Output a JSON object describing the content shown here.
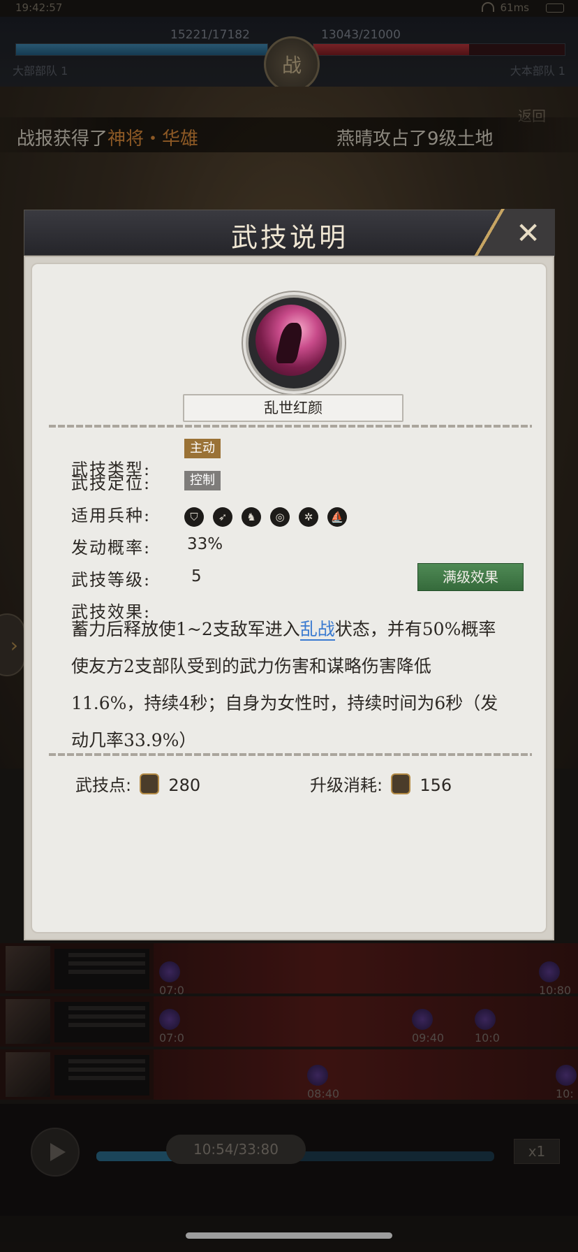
{
  "status_bar": {
    "time": "19:42:57",
    "network": "61ms"
  },
  "battle": {
    "left_hp": "15221/17182",
    "right_hp": "13043/21000",
    "center_label": "战",
    "left_team": "大部部队 1",
    "right_team": "大本部队 1",
    "back_label": "返回"
  },
  "ticker": {
    "left_prefix": "战报获得了",
    "left_highlight": "神将・华雄",
    "right_text": "燕晴攻占了9级土地"
  },
  "timeline": {
    "markers": [
      "07:0",
      "10:80",
      "07:0",
      "09:40",
      "10:0",
      "08:40",
      "10:"
    ]
  },
  "playback": {
    "time": "10:54/33:80",
    "speed": "x1",
    "progress": 0.32
  },
  "dialog": {
    "title": "武技说明",
    "skill_name": "乱世红颜",
    "fields": {
      "type_label": "武技类型:",
      "type_value": "主动",
      "role_label": "武技定位:",
      "role_value": "控制",
      "troops_label": "适用兵种:",
      "troop_icons": [
        "shield-icon",
        "spear-icon",
        "horse-icon",
        "bow-icon",
        "wheel-icon",
        "ship-icon"
      ],
      "chance_label": "发动概率:",
      "chance_value": "33%",
      "level_label": "武技等级:",
      "level_value": "5",
      "effect_label": "武技效果:"
    },
    "max_effect_button": "满级效果",
    "description": {
      "before_link": "蓄力后释放使1~2支敌军进入",
      "link": "乱战",
      "after_link": "状态，并有50%概率使友方2支部队受到的武力伤害和谋略伤害降低11.6%，持续4秒；自身为女性时，持续时间为6秒（发动几率33.9%）"
    },
    "points_label": "武技点:",
    "points_value": "280",
    "upgrade_label": "升级消耗:",
    "upgrade_value": "156"
  },
  "colors": {
    "tag_active": "#9a7236",
    "tag_control": "#7e7c7a",
    "max_button": "#3f7a45",
    "link": "#3a7ad0",
    "ticker_highlight": "#d9893a"
  }
}
